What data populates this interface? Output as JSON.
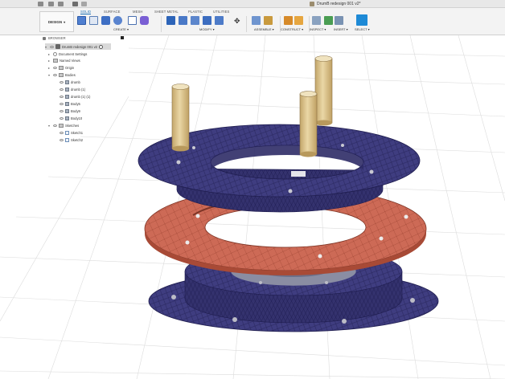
{
  "title_bar": {
    "document_title": "DrumB redesign 001 v2*",
    "icons": [
      "grid-menu-icon",
      "file-icon",
      "save-icon",
      "undo-icon",
      "redo-icon"
    ]
  },
  "toolbar": {
    "workspace": "DESIGN",
    "tabs": [
      {
        "label": "SOLID",
        "active": true
      },
      {
        "label": "SURFACE",
        "active": false
      },
      {
        "label": "MESH",
        "active": false
      },
      {
        "label": "SHEET METAL",
        "active": false
      },
      {
        "label": "PLASTIC",
        "active": false
      },
      {
        "label": "UTILITIES",
        "active": false
      }
    ],
    "groups": [
      "CREATE ▾",
      "MODIFY ▾",
      "ASSEMBLE ▾",
      "CONSTRUCT ▾",
      "INSPECT ▾",
      "INSERT ▾",
      "SELECT ▾"
    ]
  },
  "browser": {
    "header": "BROWSER",
    "root": "DrumB redesign 001 v2",
    "items": [
      {
        "label": "Document Settings"
      },
      {
        "label": "Named Views"
      },
      {
        "label": "Origin"
      },
      {
        "label": "Bodies"
      },
      {
        "label": "drumb"
      },
      {
        "label": "drumb (1)"
      },
      {
        "label": "drumb (1) (1)"
      },
      {
        "label": "Body5"
      },
      {
        "label": "Body9"
      },
      {
        "label": "Body10"
      },
      {
        "label": "Sketches"
      },
      {
        "label": "Sketch1"
      },
      {
        "label": "Sketch2"
      }
    ]
  },
  "viewport": {
    "colors": {
      "blue_body": "#3f3d80",
      "blue_dark": "#2a2860",
      "red_body": "#cd6a56",
      "red_dark": "#a44a38",
      "pin": "#e0c890",
      "pin_shade": "#c3a66a",
      "grid": "#dcdcdc"
    }
  }
}
